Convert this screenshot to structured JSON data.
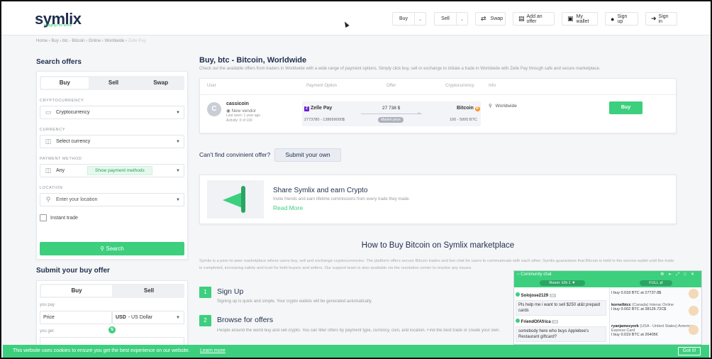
{
  "header": {
    "logo": "symlix",
    "tagline": "bridging the world",
    "nav": {
      "buy": "Buy",
      "sell": "Sell",
      "swap": "Swap",
      "add_offer": "Add an offer",
      "wallet": "My wallet",
      "sign_up": "Sign up",
      "sign_in": "Sign in"
    }
  },
  "breadcrumb": [
    "Home",
    "Buy",
    "btc - Bitcoin",
    "Online",
    "Worldwide",
    "Zelle Pay"
  ],
  "search": {
    "title": "Search offers",
    "tabs": [
      "Buy",
      "Sell",
      "Swap"
    ],
    "crypto_label": "CRYPTOCURRENCY",
    "crypto_value": "Cryptocurrency",
    "currency_label": "CURRENCY",
    "currency_value": "Select currency",
    "payment_label": "PAYMENT METHOD",
    "payment_value": "Any",
    "payment_button": "Show payment methods",
    "location_label": "LOCATION",
    "location_placeholder": "Enter your location",
    "instant": "Instant trade",
    "button": "Search"
  },
  "buy_request": {
    "title": "Submit your buy offer",
    "tabs": [
      "Buy",
      "Sell"
    ],
    "you_pay": "you pay",
    "price": "Price",
    "currency": "USD",
    "currency_name": "- US Dollar",
    "you_get": "you get"
  },
  "main": {
    "title": "Buy, btc - Bitcoin, Worldwide",
    "description": "Check out the available offers from traders in Worldwide with a wide range of payment options. Simply click buy, sell or exchange to initiate a trade in Worldwide with Zelle Pay through safe and secure marketplace.",
    "columns": [
      "User",
      "Payment Option",
      "Offer",
      "Cryptocurrency",
      "Info"
    ],
    "offer": {
      "user": "cassicoin",
      "vendor_badge": "New vendor",
      "last_seen": "Last seen: 1 year ago",
      "activity": "Activity: 0 of 100",
      "payment": "Zelle Pay",
      "payment_range": "2773780 - 138699000$",
      "price": "27 738 $",
      "price_tag": "Market price",
      "crypto": "Bitcoin",
      "crypto_range": "100 - 5000 BTC",
      "location": "Worldwide",
      "buy_button": "Buy"
    },
    "cant_find": "Can't find convinient offer?",
    "submit_own": "Submit your own",
    "share": {
      "title": "Share Symlix and earn Crypto",
      "desc": "Invite friends and earn lifetime commissions from every trade they made.",
      "link": "Read More"
    },
    "how_title": "How to Buy Bitcoin on Symlix marketplace",
    "how_desc": "Symlix is a peer-to-peer marketplace where users buy, sell and exchange cryptocurrencies. The platform offers secure Bitcoin trades and live chat for users to communicate with each other. Symlix guarantees that Bitcoin is held in the escrow wallet until the trade is completed, increasing safety and trust for both buyers and sellers. Our support team is also available via the resolution center to resolve any issues.",
    "steps": [
      {
        "num": "1",
        "title": "Sign Up",
        "desc": "Signing up is quick and simple. Your crypto wallets will be generated automatically."
      },
      {
        "num": "2",
        "title": "Browse for offers",
        "desc": "People around the world buy and sell crypto. You can filter offers by payment type, currency, coin, and location. Find the best trade or create your own."
      }
    ]
  },
  "chat": {
    "title": "Community chat",
    "room": "Room: EN-1",
    "mode": "FULL",
    "messages": [
      {
        "user": "Solojose2129",
        "badge": "10",
        "text": "Pls help me i want to sell $250 at&t prepaid cards"
      },
      {
        "user": "FriendOfAfrica",
        "badge": "10",
        "text": "somebody here who buys Applebee's Restaurant giftcard?"
      }
    ],
    "trades": [
      {
        "text": "I buy 0.018 BTC at 27737.8$"
      },
      {
        "name": "kornelbtcc",
        "meta": "(Canada) Interac Online",
        "text": "I buy 0.002 BTC at 38126.72C$"
      },
      {
        "name": "ryanjamesyork",
        "meta": "(USA - United States) American Express Card",
        "text": "I buy 0.019 BTC at 26405€"
      }
    ]
  },
  "cookie": {
    "text": "This website uses cookies to ensure you get the best experience on our website.",
    "link": "Learn more",
    "button": "Got it!"
  }
}
